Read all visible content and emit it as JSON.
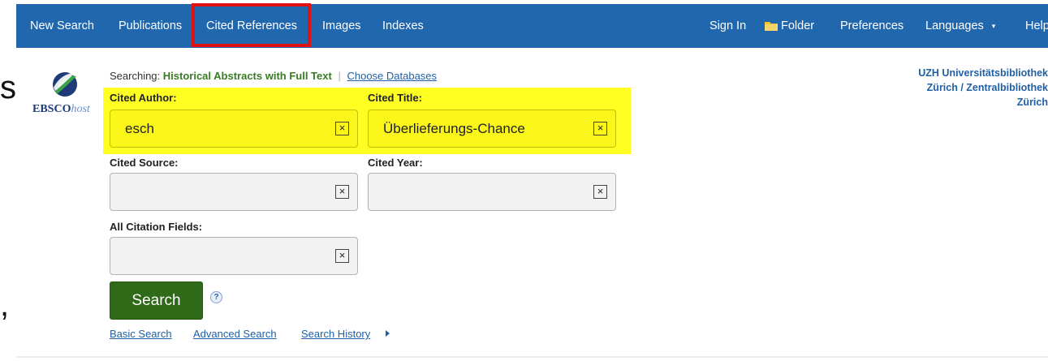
{
  "nav": {
    "new_search": "New Search",
    "publications": "Publications",
    "cited_references": "Cited References",
    "images": "Images",
    "indexes": "Indexes",
    "sign_in": "Sign In",
    "folder": "Folder",
    "preferences": "Preferences",
    "languages": "Languages",
    "help": "Help",
    "folder_icon": "folder-icon",
    "languages_caret": "▾"
  },
  "logo": {
    "brand": "EBSCO",
    "suffix": "host"
  },
  "searching": {
    "prefix": "Searching:",
    "database": "Historical Abstracts with Full Text",
    "choose_databases": "Choose Databases"
  },
  "institution": {
    "line1": "UZH Universitätsbibliothek",
    "line2": "Zürich / Zentralbibliothek",
    "line3": "Zürich"
  },
  "fields": {
    "cited_author": {
      "label": "Cited Author:",
      "value": "esch"
    },
    "cited_title": {
      "label": "Cited Title:",
      "value": "Überlieferungs-Chance"
    },
    "cited_source": {
      "label": "Cited Source:",
      "value": ""
    },
    "cited_year": {
      "label": "Cited Year:",
      "value": ""
    },
    "all_citation_fields": {
      "label": "All Citation Fields:",
      "value": ""
    },
    "clear_glyph": "×"
  },
  "actions": {
    "search": "Search",
    "help_glyph": "?",
    "basic_search": "Basic Search",
    "advanced_search": "Advanced Search",
    "search_history": "Search History"
  },
  "colors": {
    "nav_bg": "#2167ae",
    "highlight_red": "#e11111",
    "highlight_yellow": "#ffff22",
    "search_button": "#2e6a17",
    "link_blue": "#1f5fa7",
    "database_green": "#3a7a26"
  },
  "cropped_fragments": {
    "upper": "s",
    "lower": ","
  }
}
